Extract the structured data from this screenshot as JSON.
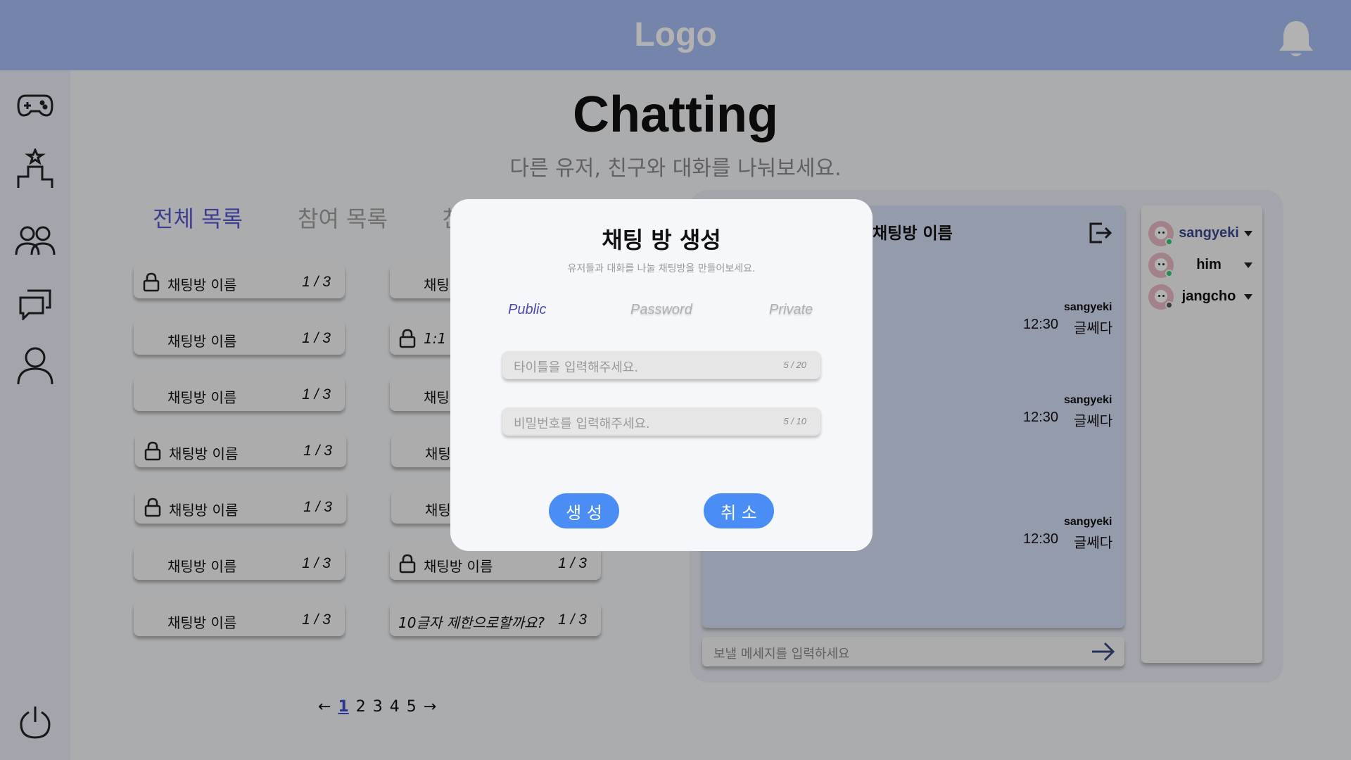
{
  "header": {
    "logo": "Logo"
  },
  "page": {
    "title": "Chatting",
    "subtitle": "다른 유저, 친구와 대화를 나눠보세요."
  },
  "tabs": [
    {
      "label": "전체 목록",
      "active": true
    },
    {
      "label": "참여 목록",
      "active": false
    },
    {
      "label": "친",
      "active": false
    }
  ],
  "rooms": [
    {
      "name": "채팅방 이름",
      "count": "1 / 3",
      "locked": true
    },
    {
      "name": "채팅방 이름",
      "count": "1 / 3",
      "locked": false
    },
    {
      "name": "채팅방 이름",
      "count": "1 / 3",
      "locked": false
    },
    {
      "name": "채팅방 이름",
      "count": "1 / 3",
      "locked": true
    },
    {
      "name": "채팅방 이름",
      "count": "1 / 3",
      "locked": true
    },
    {
      "name": "채팅방 이름",
      "count": "1 / 3",
      "locked": false
    },
    {
      "name": "채팅방 이름",
      "count": "1 / 3",
      "locked": false
    },
    {
      "name": "채팅",
      "count": "",
      "locked": false
    },
    {
      "name": "1:1",
      "count": "",
      "locked": true
    },
    {
      "name": "채팅",
      "count": "",
      "locked": false
    },
    {
      "name": "채팅",
      "count": "",
      "locked": false
    },
    {
      "name": "채팅",
      "count": "",
      "locked": false
    },
    {
      "name": "채팅방 이름",
      "count": "1 / 3",
      "locked": true
    },
    {
      "name": "10글자 제한으로할까요?",
      "count": "1 / 3",
      "locked": false
    }
  ],
  "pagination": {
    "prev": "←",
    "pages": [
      "1",
      "2",
      "3",
      "4",
      "5"
    ],
    "current": "1",
    "next": "→"
  },
  "chat": {
    "room_name": "채팅방 이름",
    "messages": [
      {
        "user": "sangyeki",
        "time": "12:30",
        "text": "글쎄다"
      },
      {
        "user": "sangyeki",
        "time": "12:30",
        "text": "글쎄다"
      },
      {
        "user": "sangyeki",
        "time": "12:30",
        "text": "글쎄다"
      }
    ],
    "input_placeholder": "보낼 메세지를 입력하세요"
  },
  "participants": [
    {
      "name": "sangyeki",
      "online": true,
      "highlight": true
    },
    {
      "name": "him",
      "online": true,
      "highlight": false
    },
    {
      "name": "jangcho",
      "online": false,
      "highlight": false
    }
  ],
  "modal": {
    "title": "채팅 방 생성",
    "subtitle": "유저들과 대화를 나눌 채팅방을 만들어보세요.",
    "tabs": [
      "Public",
      "Password",
      "Private"
    ],
    "active_tab": "Public",
    "title_input": {
      "placeholder": "타이틀을 입력해주세요.",
      "counter": "5 / 20"
    },
    "password_input": {
      "placeholder": "비밀번호를 입력해주세요.",
      "counter": "5 / 10"
    },
    "create_label": "생 성",
    "cancel_label": "취 소"
  },
  "colors": {
    "header": "#a6bef4",
    "accent": "#4a8ef5",
    "active_tab": "#5a5ad0",
    "online": "#2ecc71",
    "offline": "#555555"
  }
}
